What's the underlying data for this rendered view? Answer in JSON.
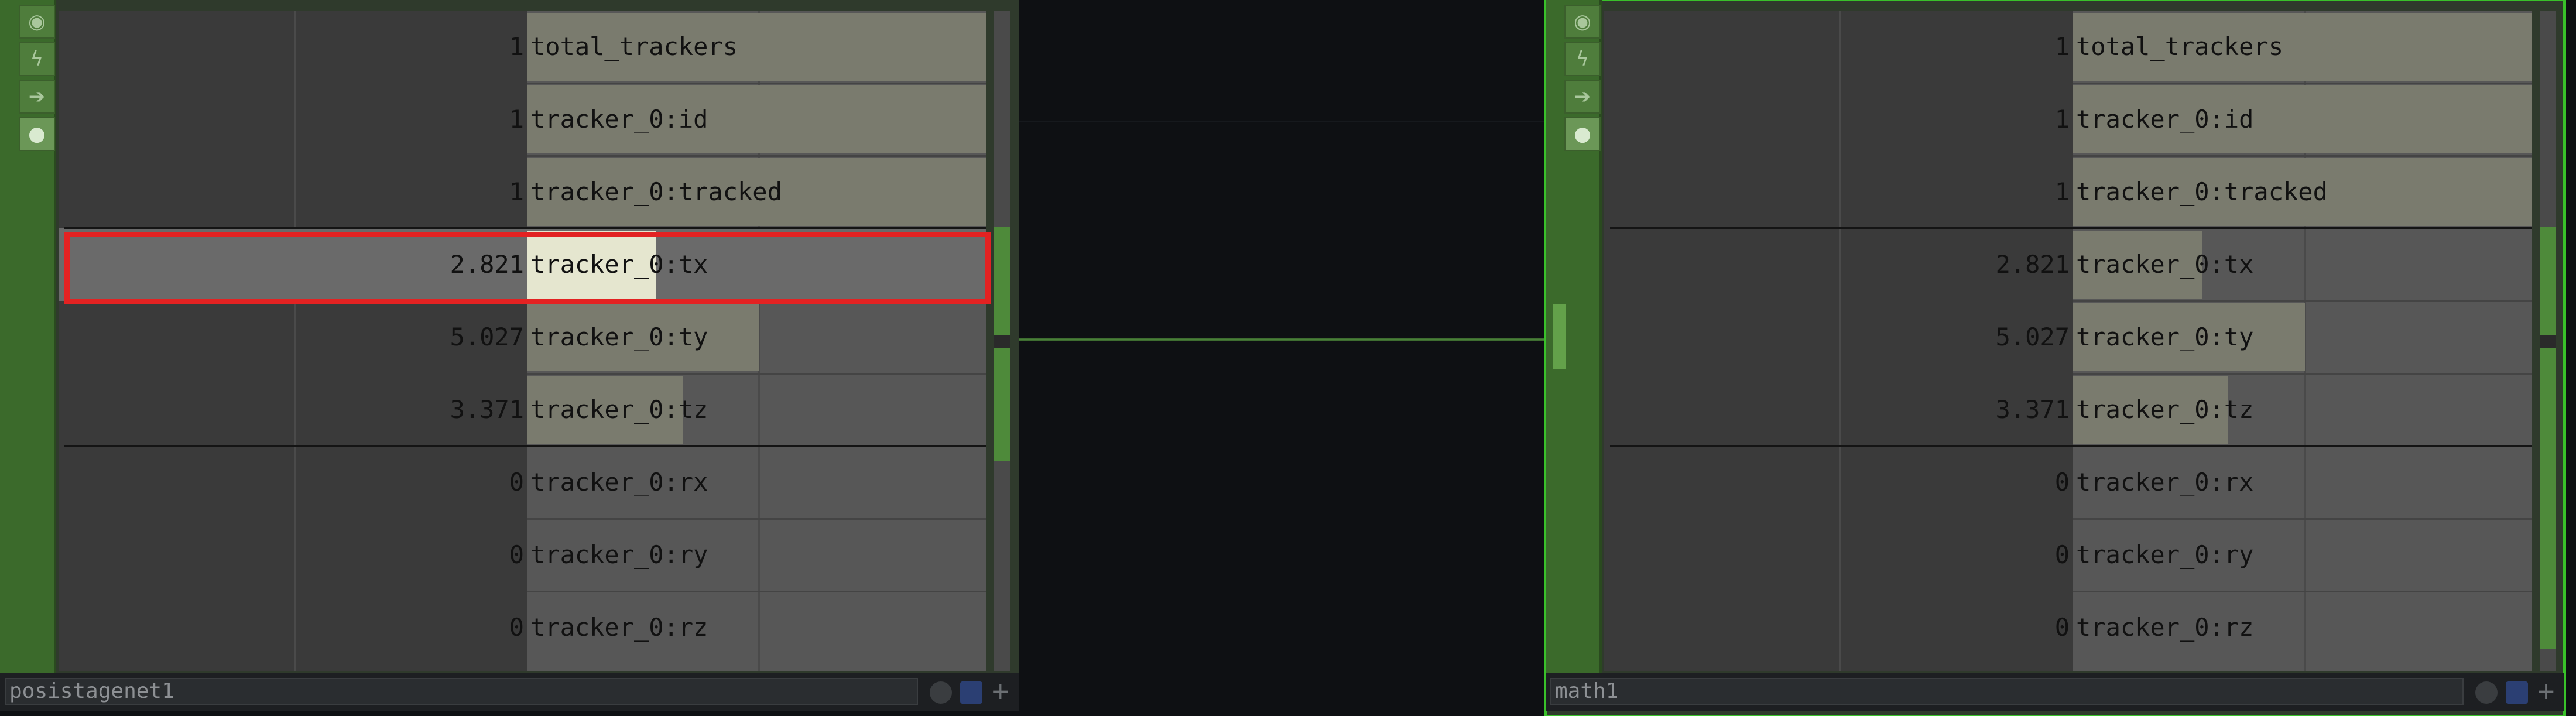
{
  "colors": {
    "background": "#0e1013",
    "node_body": "#2f3a2c",
    "sidebar": "#3b6a2b",
    "selection_outline": "#39c12a",
    "highlight_box": "#e32222",
    "bar": "#7a7b6e",
    "bar_highlight": "#e5e6cf",
    "wire": "#4f8a3c"
  },
  "icons": {
    "viewer_flag": "target-icon",
    "bypass_flag": "lightning-icon",
    "display_flag": "arrow-right-icon",
    "lock_flag": "lock-icon"
  },
  "nodes": [
    {
      "name": "posistagenet1",
      "selected": false,
      "channels": [
        {
          "value": "1",
          "name": "total_trackers",
          "level": 1.0
        },
        {
          "value": "1",
          "name": "tracker_0:id",
          "level": 1.0
        },
        {
          "value": "1",
          "name": "tracker_0:tracked",
          "level": 1.0
        },
        {
          "value": "2.821",
          "name": "tracker_0:tx",
          "level": 0.28,
          "highlighted": true
        },
        {
          "value": "5.027",
          "name": "tracker_0:ty",
          "level": 0.503
        },
        {
          "value": "3.371",
          "name": "tracker_0:tz",
          "level": 0.337
        },
        {
          "value": "0",
          "name": "tracker_0:rx",
          "level": 0
        },
        {
          "value": "0",
          "name": "tracker_0:ry",
          "level": 0
        },
        {
          "value": "0",
          "name": "tracker_0:rz",
          "level": 0
        }
      ]
    },
    {
      "name": "math1",
      "selected": true,
      "channels": [
        {
          "value": "1",
          "name": "total_trackers",
          "level": 1.0
        },
        {
          "value": "1",
          "name": "tracker_0:id",
          "level": 1.0
        },
        {
          "value": "1",
          "name": "tracker_0:tracked",
          "level": 1.0
        },
        {
          "value": "2.821",
          "name": "tracker_0:tx",
          "level": 0.28
        },
        {
          "value": "5.027",
          "name": "tracker_0:ty",
          "level": 0.503
        },
        {
          "value": "3.371",
          "name": "tracker_0:tz",
          "level": 0.337
        },
        {
          "value": "0",
          "name": "tracker_0:rx",
          "level": 0
        },
        {
          "value": "0",
          "name": "tracker_0:ry",
          "level": 0
        },
        {
          "value": "0",
          "name": "tracker_0:rz",
          "level": 0
        }
      ]
    }
  ]
}
